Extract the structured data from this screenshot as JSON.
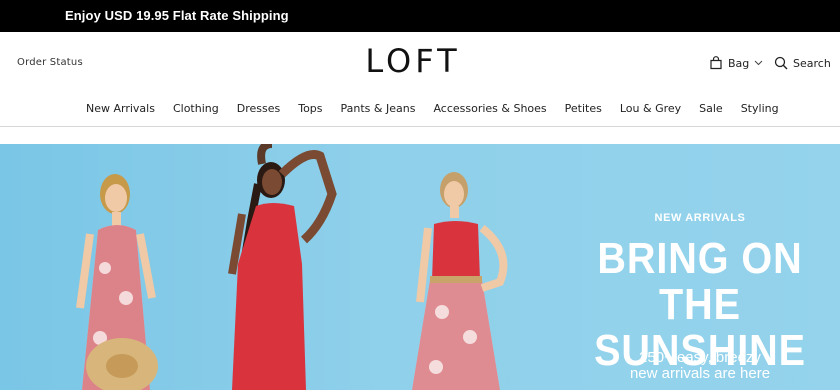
{
  "promo": {
    "text": "Enjoy USD 19.95 Flat Rate Shipping"
  },
  "header": {
    "order_status": "Order Status",
    "logo": "LOFT",
    "bag_label": "Bag",
    "search_label": "Search"
  },
  "nav": {
    "items": [
      "New Arrivals",
      "Clothing",
      "Dresses",
      "Tops",
      "Pants & Jeans",
      "Accessories & Shoes",
      "Petites",
      "Lou & Grey",
      "Sale",
      "Styling"
    ]
  },
  "hero": {
    "eyebrow": "NEW ARRIVALS",
    "headline_line1": "BRING ON",
    "headline_line2": "THE SUNSHINE",
    "sub_line1": "250+ easy, breezy",
    "sub_line2": "new arrivals are here",
    "background_color": "#8fd0ea",
    "dress_red": "#d9343d"
  }
}
